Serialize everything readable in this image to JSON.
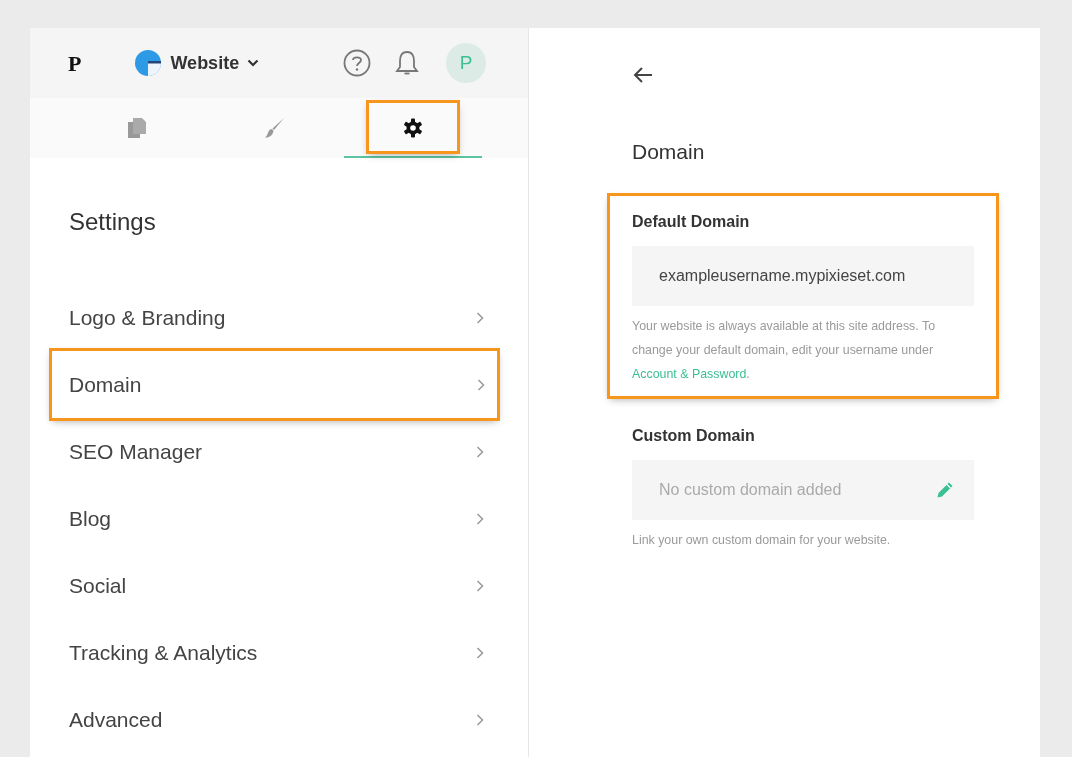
{
  "header": {
    "logo": "P",
    "site_name": "Website",
    "avatar_letter": "P"
  },
  "tabs": [
    {
      "kind": "pages",
      "selected": false,
      "highlighted": false
    },
    {
      "kind": "design",
      "selected": false,
      "highlighted": false
    },
    {
      "kind": "settings",
      "selected": true,
      "highlighted": true
    }
  ],
  "sidebar": {
    "title": "Settings",
    "items": [
      {
        "label": "Logo & Branding",
        "highlighted": false
      },
      {
        "label": "Domain",
        "highlighted": true
      },
      {
        "label": "SEO Manager",
        "highlighted": false
      },
      {
        "label": "Blog",
        "highlighted": false
      },
      {
        "label": "Social",
        "highlighted": false
      },
      {
        "label": "Tracking & Analytics",
        "highlighted": false
      },
      {
        "label": "Advanced",
        "highlighted": false
      }
    ]
  },
  "detail": {
    "title": "Domain",
    "sections": [
      {
        "heading": "Default Domain",
        "kind": "readonly",
        "value": "exampleusername.mypixieset.com",
        "help": "Your website is always available at this site address. To change your default domain, edit your username under ",
        "link": "Account & Password",
        "help_after": ".",
        "highlighted": true
      },
      {
        "heading": "Custom Domain",
        "kind": "editable",
        "placeholder": "No custom domain added",
        "help": "Link your own custom domain for your website.",
        "highlighted": false
      }
    ]
  }
}
